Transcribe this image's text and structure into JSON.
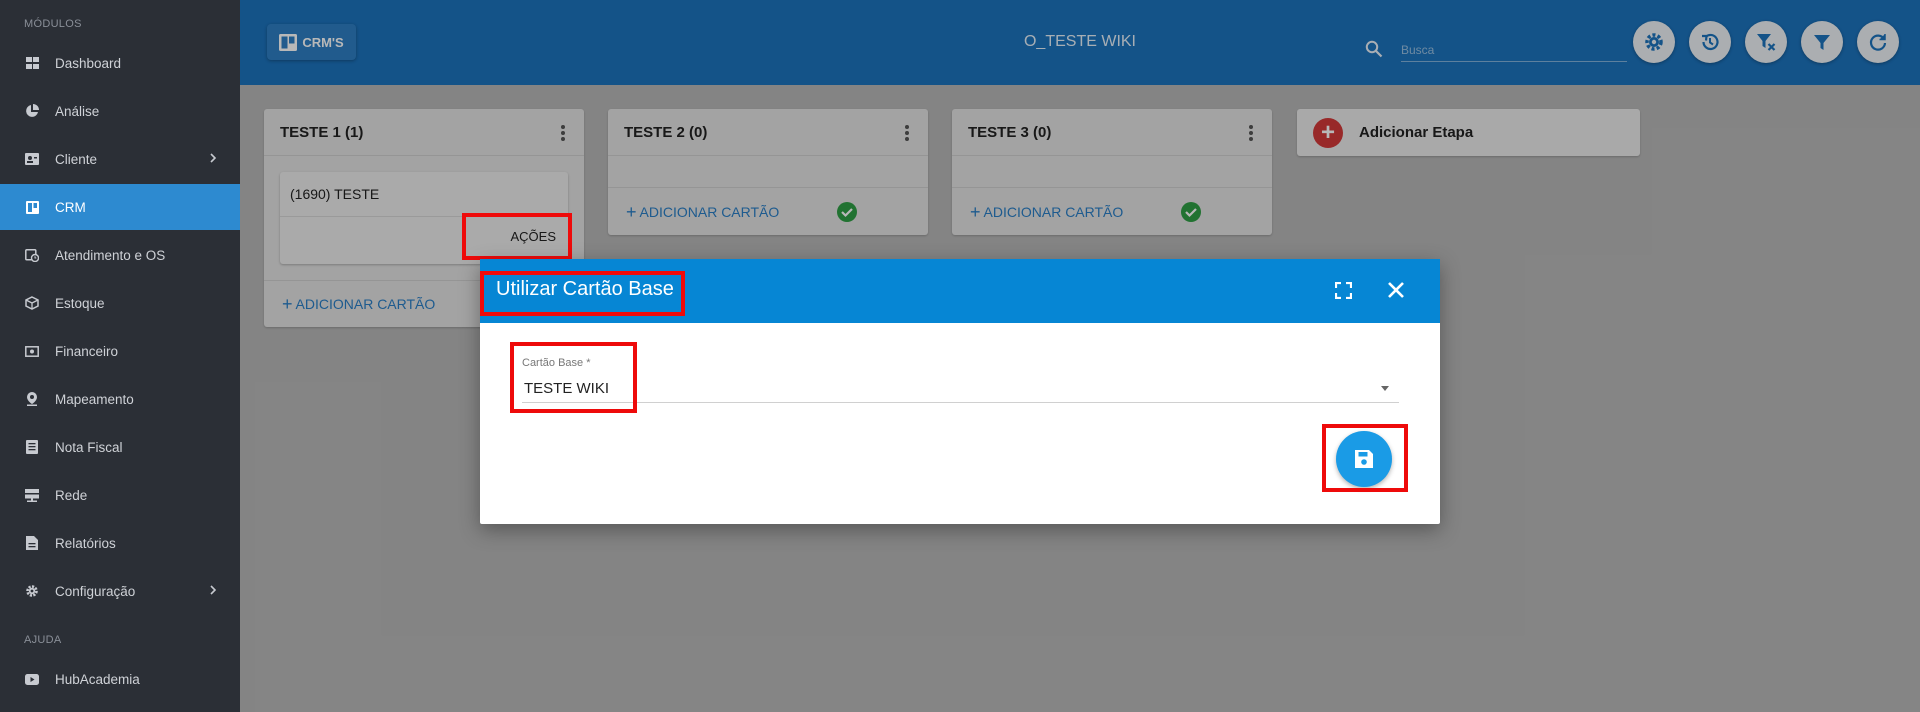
{
  "sidebar": {
    "section_modules": "MÓDULOS",
    "section_help": "AJUDA",
    "items": [
      {
        "label": "Dashboard",
        "icon": "grid-icon"
      },
      {
        "label": "Análise",
        "icon": "pie-chart-icon"
      },
      {
        "label": "Cliente",
        "icon": "contact-card-icon",
        "expandable": true
      },
      {
        "label": "CRM",
        "icon": "board-icon",
        "active": true
      },
      {
        "label": "Atendimento e OS",
        "icon": "calendar-clock-icon"
      },
      {
        "label": "Estoque",
        "icon": "box-icon"
      },
      {
        "label": "Financeiro",
        "icon": "money-icon"
      },
      {
        "label": "Mapeamento",
        "icon": "map-pin-icon"
      },
      {
        "label": "Nota Fiscal",
        "icon": "document-icon"
      },
      {
        "label": "Rede",
        "icon": "server-icon"
      },
      {
        "label": "Relatórios",
        "icon": "report-icon"
      },
      {
        "label": "Configuração",
        "icon": "gear-icon",
        "expandable": true
      }
    ],
    "help_items": [
      {
        "label": "HubAcademia",
        "icon": "youtube-icon"
      }
    ]
  },
  "header": {
    "crms_label": "CRM'S",
    "title": "O_TESTE WIKI",
    "search_placeholder": "Busca",
    "buttons": [
      "settings-icon",
      "history-icon",
      "filter-clear-icon",
      "filter-icon",
      "refresh-icon"
    ]
  },
  "board": {
    "columns": [
      {
        "title": "TESTE 1 (1)",
        "cards": [
          {
            "title": "(1690) TESTE",
            "action": "AÇÕES"
          }
        ],
        "add_label": "ADICIONAR CARTÃO"
      },
      {
        "title": "TESTE 2 (0)",
        "cards": [],
        "add_label": "ADICIONAR CARTÃO"
      },
      {
        "title": "TESTE 3 (0)",
        "cards": [],
        "add_label": "ADICIONAR CARTÃO"
      }
    ],
    "add_stage_label": "Adicionar Etapa"
  },
  "modal": {
    "title": "Utilizar Cartão Base",
    "field_label": "Cartão Base *",
    "field_value": "TESTE WIKI"
  },
  "colors": {
    "sidebar_bg": "#2b2f36",
    "active_item": "#2d8ad0",
    "header_bg": "#1c73bd",
    "modal_header": "#0686d4",
    "save_button": "#1a9be6",
    "highlight": "#ee0a0a",
    "add_stage": "#d33a3a",
    "check": "#2f9e44"
  }
}
